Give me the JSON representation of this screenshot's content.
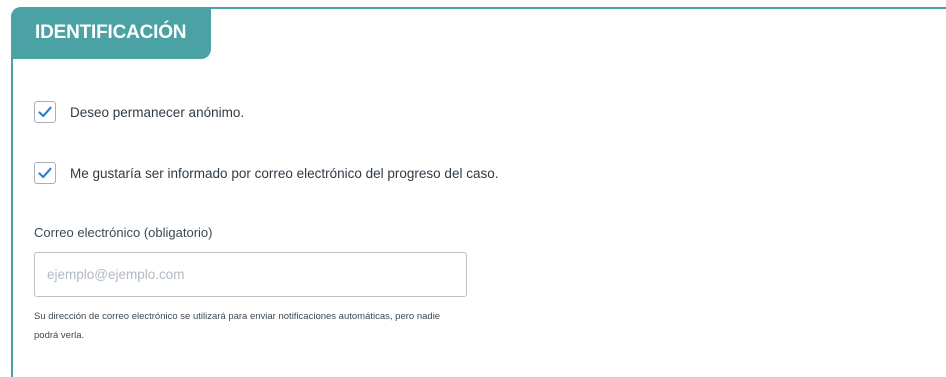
{
  "section": {
    "title": "IDENTIFICACIÓN"
  },
  "options": [
    {
      "label": "Deseo permanecer anónimo.",
      "checked": true
    },
    {
      "label": "Me gustaría ser informado por correo electrónico del progreso del caso.",
      "checked": true
    }
  ],
  "email": {
    "label": "Correo electrónico (obligatorio)",
    "value": "",
    "placeholder": "ejemplo@ejemplo.com",
    "help": "Su dirección de correo electrónico se utilizará para enviar notificaciones automáticas, pero nadie podrá verla."
  },
  "colors": {
    "accent": "#4aa2a5",
    "checkmark": "#2f7fd0"
  },
  "icons": {
    "check": "check-icon"
  }
}
